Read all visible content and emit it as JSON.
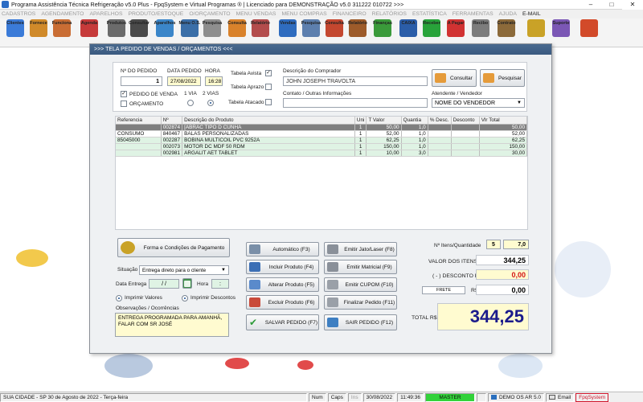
{
  "window": {
    "title": "Programa Assistência Técnica Refrigeração v5.0 Plus - FpqSystem e Virtual Programas ® | Licenciado para  DEMONSTRAÇÃO v5.0 311222 010722 >>>"
  },
  "menu": [
    {
      "label": "CADASTROS",
      "active": false
    },
    {
      "label": "AGENDAMENTO",
      "active": false
    },
    {
      "label": "APARELHOS",
      "active": false
    },
    {
      "label": "PRODUTO/ESTOQUE",
      "active": false
    },
    {
      "label": "O/ORÇAMENTO",
      "active": false
    },
    {
      "label": "MENU VENDAS",
      "active": false
    },
    {
      "label": "MENU COMPRAS",
      "active": false
    },
    {
      "label": "FINANCEIRO",
      "active": false
    },
    {
      "label": "RELATÓRIOS",
      "active": false
    },
    {
      "label": "ESTATÍSTICA",
      "active": false
    },
    {
      "label": "FERRAMENTAS",
      "active": false
    },
    {
      "label": "AJUDA",
      "active": false
    },
    {
      "label": "E-MAIL",
      "active": true
    }
  ],
  "toolbar": [
    {
      "label": "Clientes",
      "icon": "clients-icon",
      "color": "#3b7bd8"
    },
    {
      "label": "Fornece",
      "icon": "suppliers-icon",
      "color": "#d08a2a"
    },
    {
      "label": "Funciona",
      "icon": "employees-icon",
      "color": "#c96d34"
    },
    {
      "label": "Agenda",
      "icon": "calendar-icon",
      "color": "#c63a3a"
    },
    {
      "label": "Produtos",
      "icon": "products-icon",
      "color": "#6b6b6b"
    },
    {
      "label": "Consultar",
      "icon": "barcode-icon",
      "color": "#4a4a4a"
    },
    {
      "label": "Aparelhos",
      "icon": "appliance-icon",
      "color": "#3b86c9"
    },
    {
      "label": "Menu O.S.",
      "icon": "service-order-icon",
      "color": "#3b6fa8"
    },
    {
      "label": "Pesquisa",
      "icon": "search-docs-icon",
      "color": "#8e8e8e"
    },
    {
      "label": "Consulta",
      "icon": "consult-icon",
      "color": "#d9822b"
    },
    {
      "label": "Relatório",
      "icon": "report-icon",
      "color": "#b34c4c"
    },
    {
      "label": "Vendas",
      "icon": "sales-icon",
      "color": "#2f6cbf"
    },
    {
      "label": "Pesquisa",
      "icon": "search-icon",
      "color": "#5d7fae"
    },
    {
      "label": "Consulta",
      "icon": "consult-sales-icon",
      "color": "#c4472f"
    },
    {
      "label": "Relatório",
      "icon": "sales-report-icon",
      "color": "#9d5b2a"
    },
    {
      "label": "Finanças",
      "icon": "finance-icon",
      "color": "#3a9a3a"
    },
    {
      "label": "CAIXA",
      "icon": "cash-icon",
      "color": "#2b5da8"
    },
    {
      "label": "Receber",
      "icon": "receivable-icon",
      "color": "#28a33a"
    },
    {
      "label": "A Pagar",
      "icon": "payable-icon",
      "color": "#d13232"
    },
    {
      "label": "Recibo",
      "icon": "receipt-icon",
      "color": "#7c7c7c"
    },
    {
      "label": "Contrato",
      "icon": "contract-icon",
      "color": "#8c6a3a"
    },
    {
      "label": "",
      "icon": "coins-icon",
      "color": "#c9a227"
    },
    {
      "label": "Suporte",
      "icon": "support-icon",
      "color": "#7b57b5"
    },
    {
      "label": "",
      "icon": "exit-icon",
      "color": "#d24a2a"
    }
  ],
  "dialog": {
    "title": ">>>  TELA PEDIDO DE VENDAS / ORÇAMENTOS  <<<",
    "n_pedido_label": "Nº DO PEDIDO",
    "n_pedido": "1",
    "data_label": "DATA PEDIDO",
    "data": "27/08/2022",
    "hora_label": "HORA",
    "hora": "16:28",
    "tabela_avista": "Tabela Avista",
    "tabela_aprazo": "Tabela Aprazo",
    "tabela_atacado": "Tabela Atacado",
    "pedido_venda": "PEDIDO DE VENDA",
    "orcamento": "ORÇAMENTO",
    "via1": "1 VIA",
    "via2": "2 VIAS",
    "comprador_label": "Descrição do Comprador",
    "comprador": "JOHN JOSEPH TRAVOLTA",
    "contato_label": "Contato / Outras Informações",
    "contato": "",
    "atendente_label": "Atendente / Vendedor",
    "atendente": "NOME DO VENDEDOR",
    "consultar": "Consultar",
    "pesquisar": "Pesquisar"
  },
  "grid": {
    "headers": [
      "Referencia",
      "Nº",
      "Descrição do Produto",
      "Uni",
      "T Valor",
      "Quantia",
      "% Desc.",
      "Desconto",
      "Vlr Total"
    ],
    "rows": [
      {
        "ref": "",
        "n": "002874",
        "desc": "[ABRAC TIPO D CUNHA",
        "uni": "1",
        "valor": "50,00",
        "qtd": "1,0",
        "pdesc": "",
        "desconto": "",
        "total": "50,00",
        "style": "sel"
      },
      {
        "ref": "CONSUMO",
        "n": "840467",
        "desc": "BALAS PERSONALIZADAS",
        "uni": "1",
        "valor": "52,00",
        "qtd": "1,0",
        "pdesc": "",
        "desconto": "",
        "total": "52,00",
        "style": "plain"
      },
      {
        "ref": "85045000",
        "n": "002287",
        "desc": "BOBINA MULTICOIL PVC 9252A",
        "uni": "1",
        "valor": "62,25",
        "qtd": "1,0",
        "pdesc": "",
        "desconto": "",
        "total": "62,25",
        "style": "green"
      },
      {
        "ref": "",
        "n": "002073",
        "desc": "MOTOR DC MDF 50 RDM",
        "uni": "1",
        "valor": "150,00",
        "qtd": "1,0",
        "pdesc": "",
        "desconto": "",
        "total": "150,00",
        "style": "green"
      },
      {
        "ref": "",
        "n": "002981",
        "desc": "ARGALIT AET TABLET",
        "uni": "1",
        "valor": "10,00",
        "qtd": "3,0",
        "pdesc": "",
        "desconto": "",
        "total": "30,00",
        "style": "green"
      }
    ]
  },
  "bottom": {
    "forma": "Forma e Condições de Pagamento",
    "situacao_label": "Situação",
    "situacao": "Entrega direto para o cliente",
    "data_entrega_label": "Data Entrega",
    "data_entrega": "/  /",
    "hora_label": "Hora",
    "hora": ":",
    "imprimir_valores": "Imprimir Valores",
    "imprimir_descontos": "Imprimir Descontos",
    "obs_label": "Observações / Ocorrências",
    "obs_line1": "ENTREGA PROGRAMADA PARA AMANHÃ,",
    "obs_line2": "FALAR COM SR JOSÉ"
  },
  "actions": {
    "automatico": "Automático",
    "automatico_key": "(F3)",
    "incluir": "Incluir Produto",
    "incluir_key": "(F4)",
    "alterar": "Alterar Produto",
    "alterar_key": "(F5)",
    "excluir": "Excluir Produto",
    "excluir_key": "(F6)",
    "salvar": "SALVAR PEDIDO",
    "salvar_key": "(F7)",
    "jato": "Emitir Jato/Laser",
    "jato_key": "(F8)",
    "matricial": "Emitir Matricial",
    "matricial_key": "(F9)",
    "cupom": "Emitir CUPOM",
    "cupom_key": "(F10)",
    "finalizar": "Finalizar Pedido",
    "finalizar_key": "(F11)",
    "sair": "SAIR  PEDIDO",
    "sair_key": "(F12)"
  },
  "totals": {
    "itens_label": "Nº Itens/Quantidade",
    "itens": "5",
    "quantidade": "7,0",
    "valor_itens_label": "VALOR DOS ITENS R$",
    "valor_itens": "344,25",
    "desconto_label": "( - ) DESCONTO R$",
    "desconto": "0,00",
    "frete_label": "FRETE",
    "frete_currency": "R$",
    "frete": "0,00",
    "total_label": "TOTAL R$",
    "total": "344,25"
  },
  "status": {
    "city": "SUA CIDADE - SP 30 de Agosto de 2022 - Terça-feira",
    "num": "Num",
    "caps": "Caps",
    "ins": "Ins",
    "date": "30/08/2022",
    "time": "11:49:36",
    "master": "MASTER",
    "demo": "DEMO OS AR 5.0",
    "email": "Email",
    "brand": "FpqSystem"
  },
  "colors": {
    "accent": "#1b1b8c",
    "master_bg": "#32d23a",
    "discount": "#d41515"
  }
}
